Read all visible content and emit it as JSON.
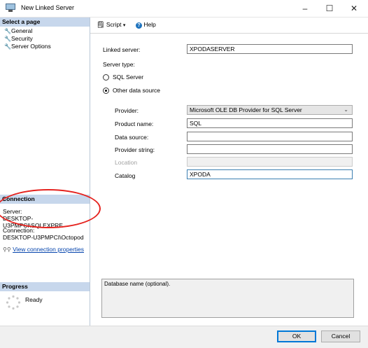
{
  "window": {
    "title": "New Linked Server",
    "minimize_glyph": "–",
    "maximize_glyph": "☐",
    "close_glyph": "✕"
  },
  "left": {
    "select_page_header": "Select a page",
    "pages": [
      {
        "label": "General",
        "icon": "wrench-icon"
      },
      {
        "label": "Security",
        "icon": "wrench-icon"
      },
      {
        "label": "Server Options",
        "icon": "wrench-icon"
      }
    ],
    "connection_header": "Connection",
    "server_label": "Server:",
    "server_value": "DESKTOP-U3PMPCI\\SQLEXPRE",
    "connection_label": "Connection:",
    "connection_value": "DESKTOP-U3PMPCI\\Octopod",
    "view_connection_properties": "View connection properties",
    "progress_header": "Progress",
    "progress_status": "Ready"
  },
  "toolbar": {
    "script_label": "Script",
    "help_label": "Help"
  },
  "form": {
    "linked_server_label": "Linked server:",
    "linked_server_value": "XPODASERVER",
    "server_type_label": "Server type:",
    "sql_server_option": "SQL Server",
    "other_source_option": "Other data source",
    "selected_server_type": "Other data source",
    "provider_label": "Provider:",
    "provider_value": "Microsoft OLE DB Provider for SQL Server",
    "product_name_label": "Product name:",
    "product_name_value": "SQL",
    "data_source_label": "Data source:",
    "data_source_value": "",
    "provider_string_label": "Provider string:",
    "provider_string_value": "",
    "location_label": "Location",
    "location_value": "",
    "catalog_label": "Catalog",
    "catalog_value": "XPODA"
  },
  "description": "Database name (optional).",
  "buttons": {
    "ok": "OK",
    "cancel": "Cancel"
  },
  "colors": {
    "section_header_bg": "#c7d7ec",
    "annotation_circle": "#e5231f",
    "link": "#0645ad"
  }
}
